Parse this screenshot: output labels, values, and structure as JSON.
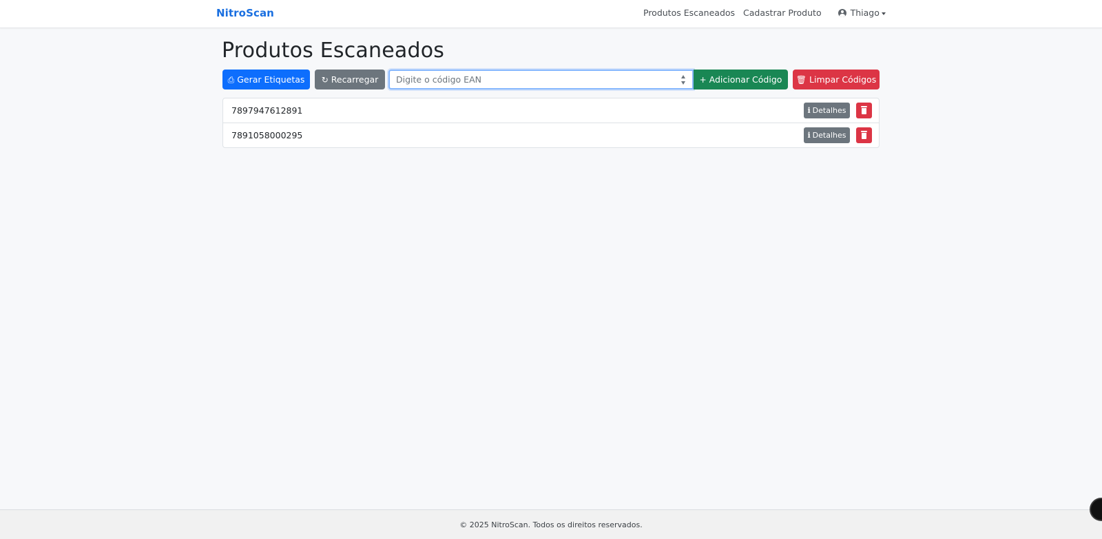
{
  "navbar": {
    "brand": "NitroScan",
    "links": [
      "Produtos Escaneados",
      "Cadastrar Produto"
    ],
    "user": {
      "name": "Thiago",
      "icon": "user-circle-icon"
    }
  },
  "page": {
    "title": "Produtos Escaneados"
  },
  "toolbar": {
    "generate_labels": {
      "label": "Gerar Etiquetas",
      "icon": "print-icon"
    },
    "reload": {
      "label": "Recarregar",
      "icon": "refresh-icon"
    },
    "ean_input": {
      "placeholder": "Digite o código EAN",
      "value": ""
    },
    "add_code": {
      "label": "Adicionar Código",
      "icon": "plus-icon"
    },
    "clear_codes": {
      "label": "Limpar Códigos",
      "icon": "trash-icon"
    }
  },
  "codes": [
    {
      "code": "7897947612891",
      "details_label": "Detalhes"
    },
    {
      "code": "7891058000295",
      "details_label": "Detalhes"
    }
  ],
  "footer": {
    "text": "© 2025 NitroScan. Todos os direitos reservados."
  },
  "colors": {
    "primary": "#0d6efd",
    "secondary": "#6c757d",
    "success": "#198754",
    "danger": "#dc3545",
    "brand": "#1a6fe0",
    "background": "#f7f8fa"
  }
}
